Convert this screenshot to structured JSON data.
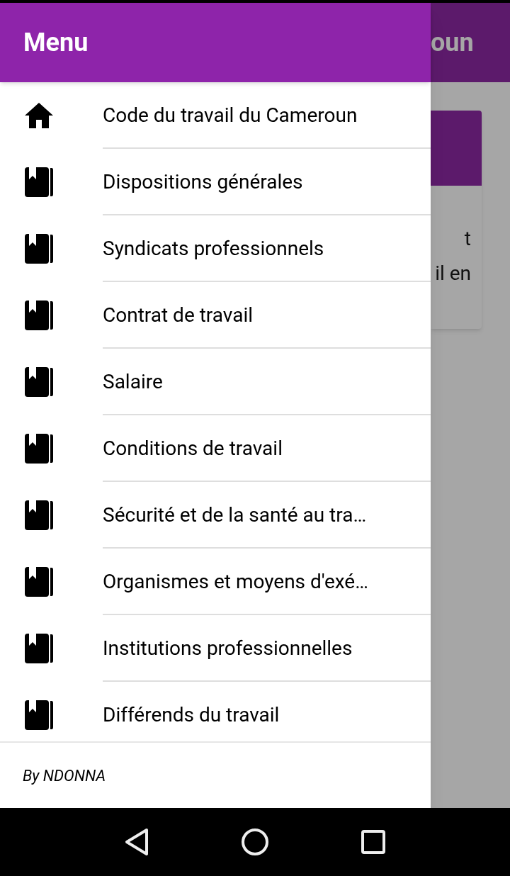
{
  "drawer": {
    "title": "Menu",
    "items": [
      {
        "kind": "home",
        "label": "Code du travail du Cameroun"
      },
      {
        "kind": "book",
        "label": "Dispositions générales"
      },
      {
        "kind": "book",
        "label": "Syndicats professionnels"
      },
      {
        "kind": "book",
        "label": "Contrat de travail"
      },
      {
        "kind": "book",
        "label": "Salaire"
      },
      {
        "kind": "book",
        "label": "Conditions de travail"
      },
      {
        "kind": "book",
        "label": "Sécurité et de la santé au tra…"
      },
      {
        "kind": "book",
        "label": "Organismes et moyens d'exé…"
      },
      {
        "kind": "book",
        "label": "Institutions professionnelles"
      },
      {
        "kind": "book",
        "label": "Différends du travail"
      }
    ],
    "footer": "By NDONNA"
  },
  "background": {
    "app_bar_title": "oun",
    "card_lines": [
      "t",
      "il en"
    ]
  }
}
